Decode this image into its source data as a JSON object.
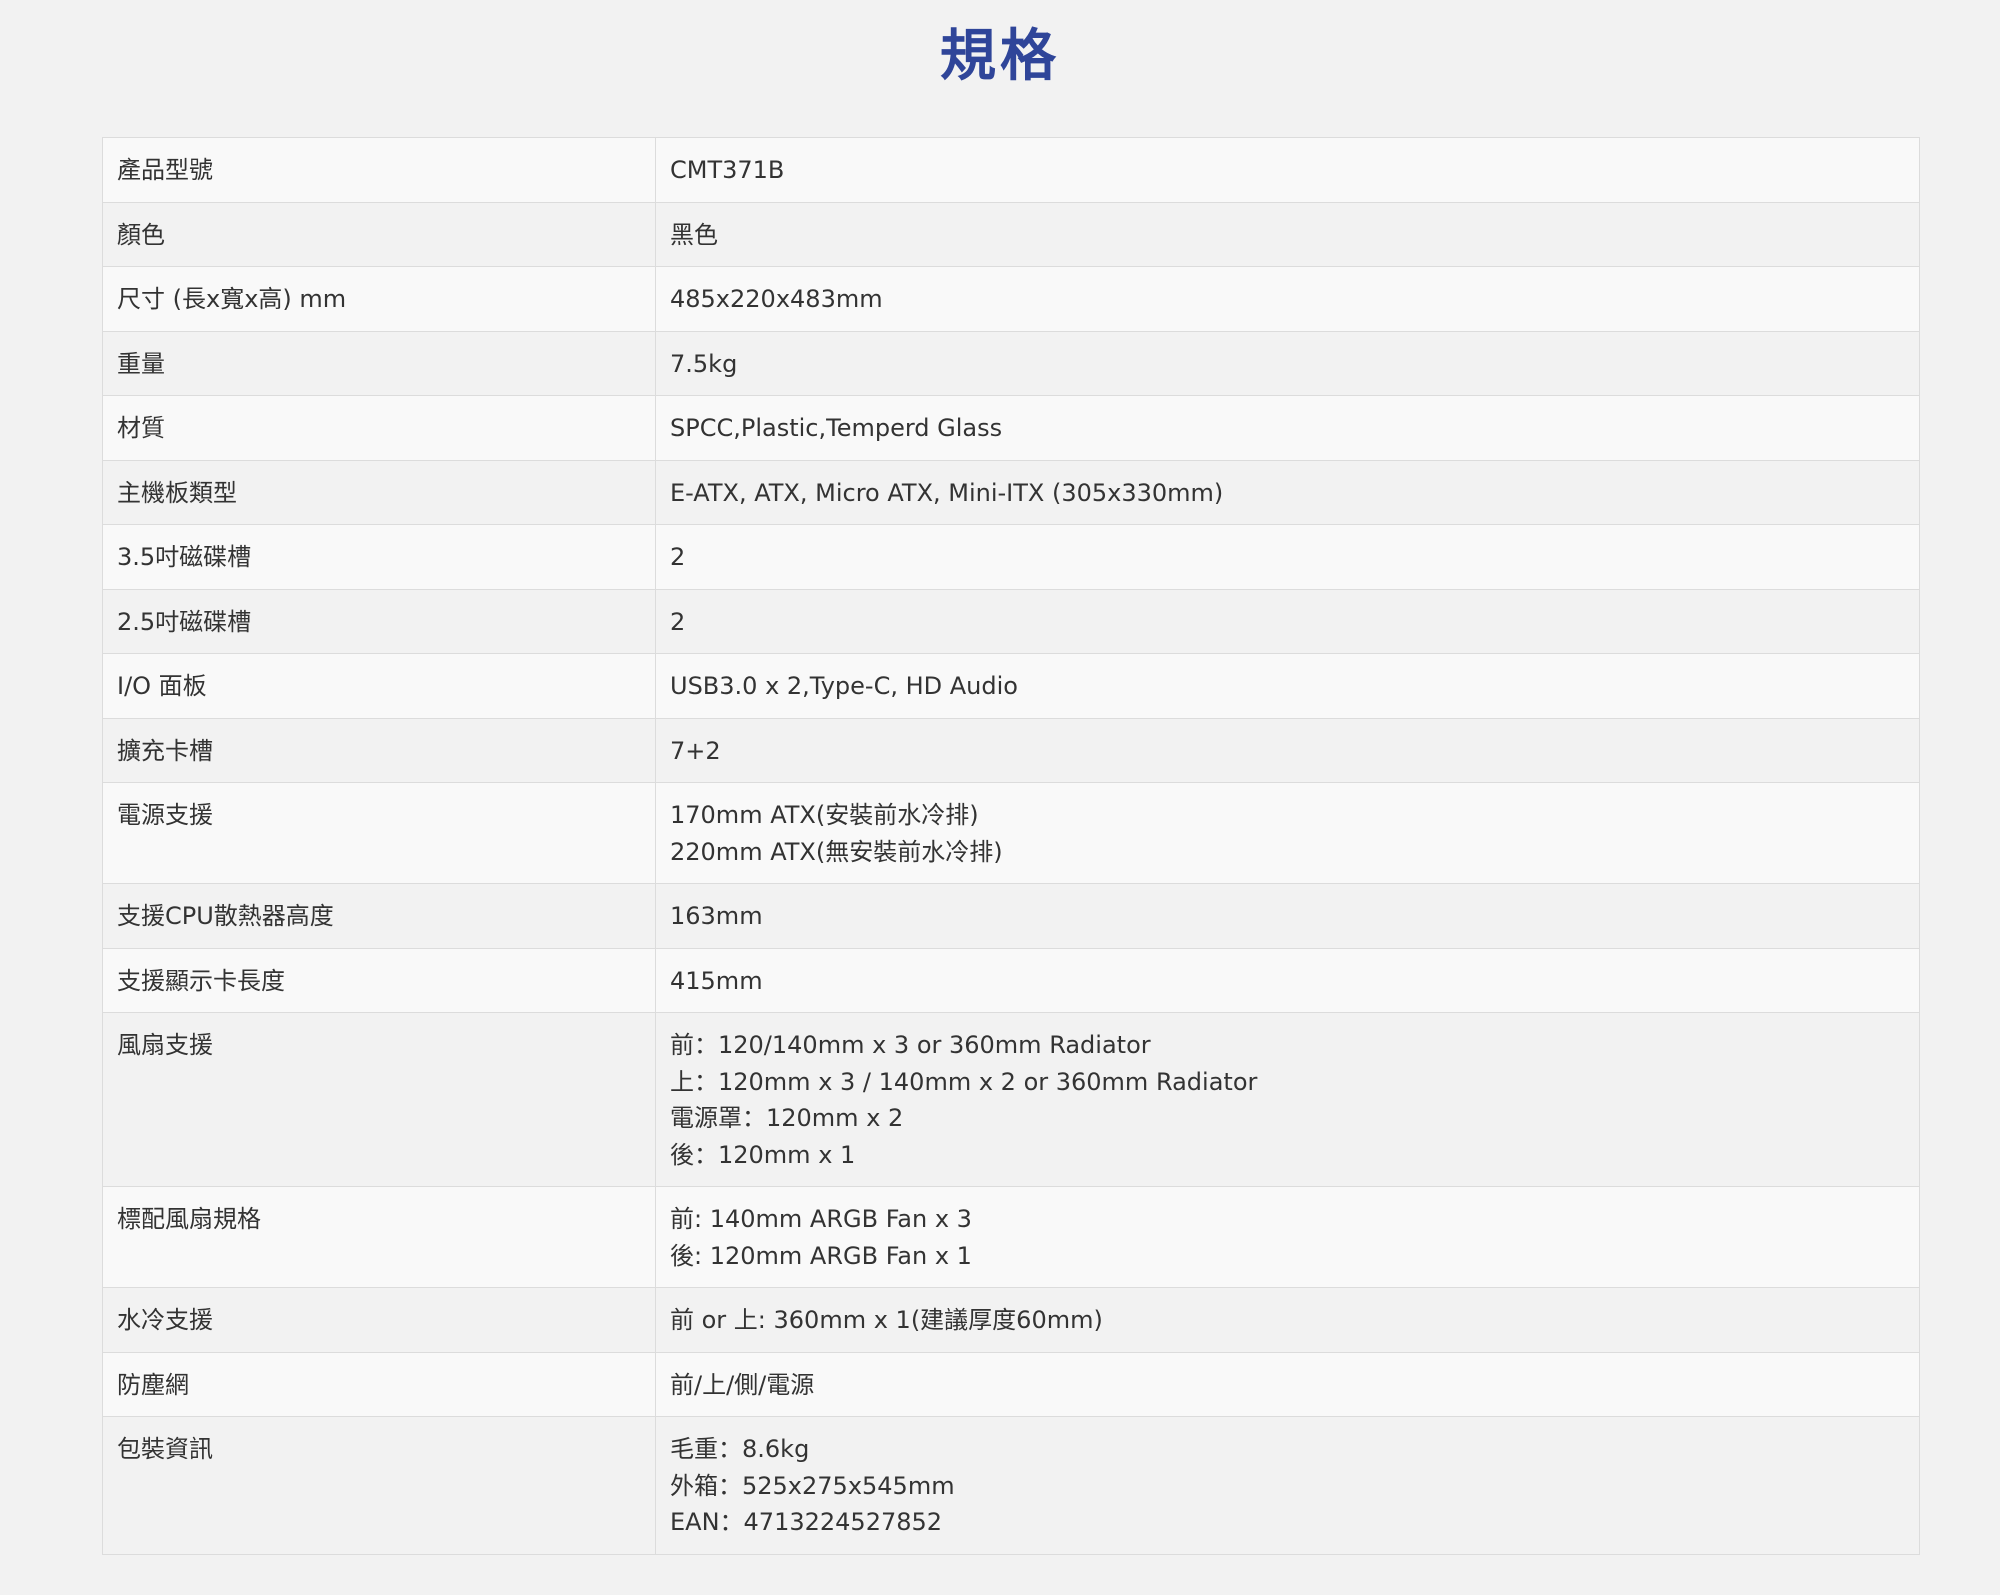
{
  "title": "規格",
  "specs": [
    {
      "label": "產品型號",
      "value": [
        "CMT371B"
      ]
    },
    {
      "label": "顏色",
      "value": [
        "黑色"
      ]
    },
    {
      "label": "尺寸 (長x寬x高) mm",
      "value": [
        "485x220x483mm"
      ]
    },
    {
      "label": "重量",
      "value": [
        "7.5kg"
      ]
    },
    {
      "label": "材質",
      "value": [
        "SPCC,Plastic,Temperd Glass"
      ]
    },
    {
      "label": "主機板類型",
      "value": [
        "E-ATX, ATX, Micro ATX, Mini-ITX (305x330mm)"
      ]
    },
    {
      "label": "3.5吋磁碟槽",
      "value": [
        "2"
      ]
    },
    {
      "label": "2.5吋磁碟槽",
      "value": [
        "2"
      ]
    },
    {
      "label": "I/O 面板",
      "value": [
        "USB3.0 x 2,Type-C, HD Audio"
      ]
    },
    {
      "label": "擴充卡槽",
      "value": [
        "7+2"
      ]
    },
    {
      "label": "電源支援",
      "value": [
        "170mm ATX(安裝前水冷排)",
        "220mm ATX(無安裝前水冷排)"
      ]
    },
    {
      "label": "支援CPU散熱器高度",
      "value": [
        "163mm"
      ]
    },
    {
      "label": "支援顯示卡長度",
      "value": [
        "415mm"
      ]
    },
    {
      "label": "風扇支援",
      "value": [
        "前：120/140mm x 3 or 360mm Radiator",
        "上：120mm x 3 / 140mm x 2 or 360mm Radiator",
        "電源罩：120mm x 2",
        "後：120mm x 1"
      ]
    },
    {
      "label": "標配風扇規格",
      "value": [
        "前: 140mm ARGB Fan x 3",
        "後: 120mm ARGB Fan x 1"
      ]
    },
    {
      "label": "水冷支援",
      "value": [
        "前 or 上: 360mm x 1(建議厚度60mm)"
      ]
    },
    {
      "label": "防塵網",
      "value": [
        "前/上/側/電源"
      ]
    },
    {
      "label": "包裝資訊",
      "value": [
        "毛重：8.6kg",
        "外箱：525x275x545mm",
        "EAN：4713224527852"
      ]
    }
  ]
}
